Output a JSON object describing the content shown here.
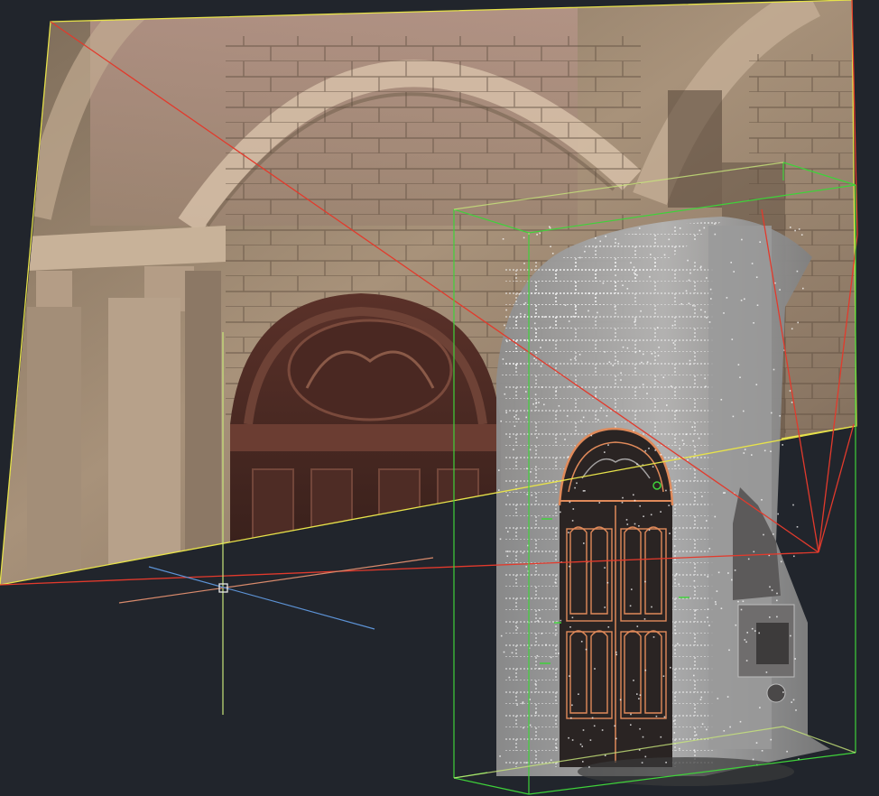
{
  "viewport": {
    "background": "#21252c",
    "icon_names": [
      "ucs-crosshair-icon",
      "pickbox-icon"
    ],
    "colors": {
      "photo_frame": "#e7e24a",
      "camera_ray": "#e23a2c",
      "bounding_box": "#3fd23a",
      "bbox_faint": "#c8e67a",
      "axis_x": "#d88a6c",
      "axis_y": "#c8e67a",
      "axis_z": "#5d93d6",
      "door_trace": "#e08a5a"
    }
  }
}
